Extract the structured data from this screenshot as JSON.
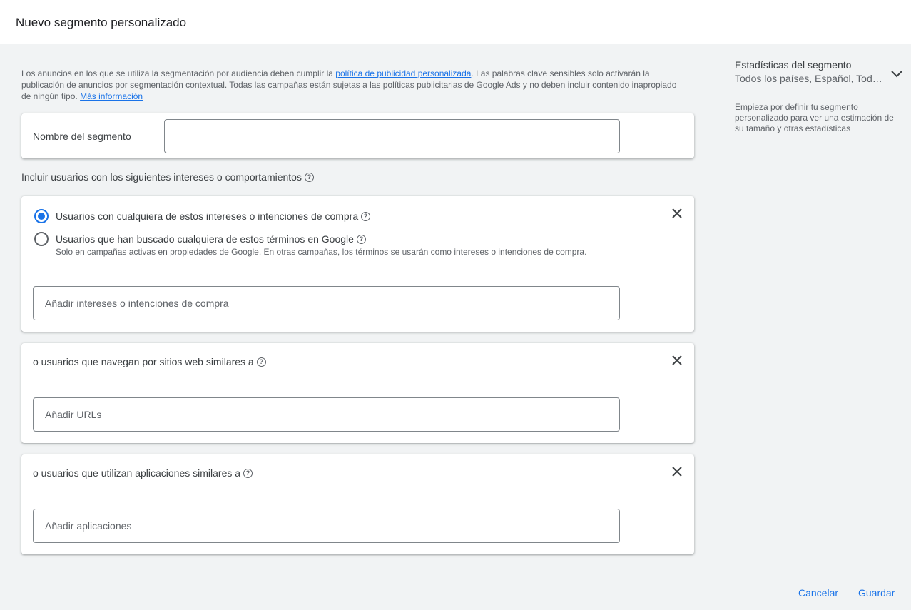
{
  "header": {
    "title": "Nuevo segmento personalizado"
  },
  "notice": {
    "text_before": "Los anuncios en los que se utiliza la segmentación por audiencia deben cumplir la ",
    "policy_link": "política de publicidad personalizada",
    "text_after": ". Las palabras clave sensibles solo activarán la publicación de anuncios por segmentación contextual. Todas las campañas están sujetas a las políticas publicitarias de Google Ads y no deben incluir contenido inapropiado de ningún tipo. ",
    "more_link": "Más información"
  },
  "segment_name": {
    "label": "Nombre del segmento",
    "value": "",
    "placeholder": ""
  },
  "include_label": "Incluir usuarios con los siguientes intereses o comportamientos",
  "interests_card": {
    "option_1": "Usuarios con cualquiera de estos intereses o intenciones de compra",
    "option_2": "Usuarios que han buscado cualquiera de estos términos en Google",
    "option_2_note": "Solo en campañas activas en propiedades de Google. En otras campañas, los términos se usarán como intereses o intenciones de compra.",
    "selected_option": 1,
    "input_placeholder": "Añadir intereses o intenciones de compra"
  },
  "websites_card": {
    "label": "o usuarios que navegan por sitios web similares a",
    "input_placeholder": "Añadir URLs"
  },
  "apps_card": {
    "label": "o usuarios que utilizan aplicaciones similares a",
    "input_placeholder": "Añadir aplicaciones"
  },
  "side": {
    "title": "Estadísticas del segmento",
    "subtitle": "Todos los países, Español, Tod…",
    "description": "Empieza por definir tu segmento personalizado para ver una estimación de su tamaño y otras estadísticas"
  },
  "footer": {
    "cancel_label": "Cancelar",
    "save_label": "Guardar"
  },
  "colors": {
    "accent": "#1a73e8",
    "background": "#f1f3f4",
    "text": "#3c4043"
  },
  "icons": {
    "help": "help-icon",
    "close": "close-icon",
    "expand": "chevron-down-icon"
  }
}
